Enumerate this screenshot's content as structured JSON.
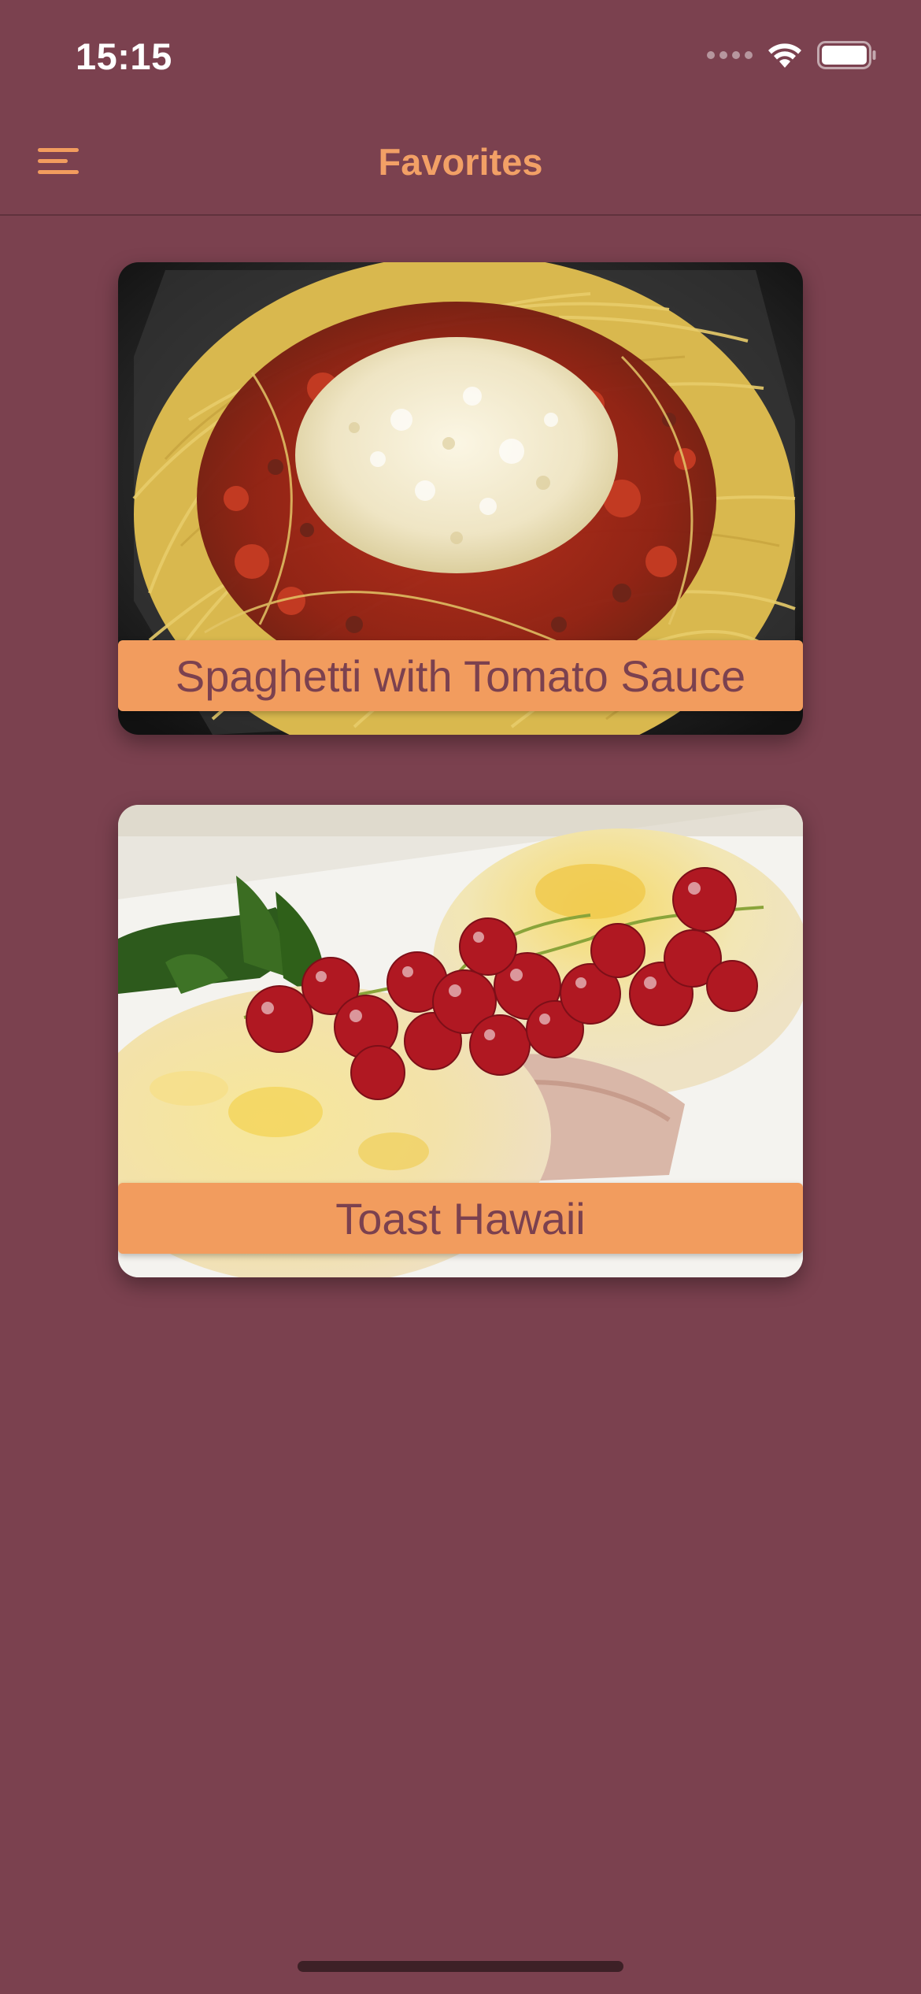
{
  "status_bar": {
    "time": "15:15",
    "icons": [
      "signal-icon",
      "wifi-icon",
      "battery-icon"
    ]
  },
  "nav": {
    "title": "Favorites",
    "menu_icon": "hamburger-menu-icon"
  },
  "favorites": [
    {
      "title": "Spaghetti with Tomato Sauce",
      "image": "spaghetti-photo"
    },
    {
      "title": "Toast Hawaii",
      "image": "toast-hawaii-photo"
    }
  ],
  "colors": {
    "background": "#7b414f",
    "accent": "#f29c5e",
    "label_text": "#7b414f",
    "status_text": "#ffffff"
  }
}
